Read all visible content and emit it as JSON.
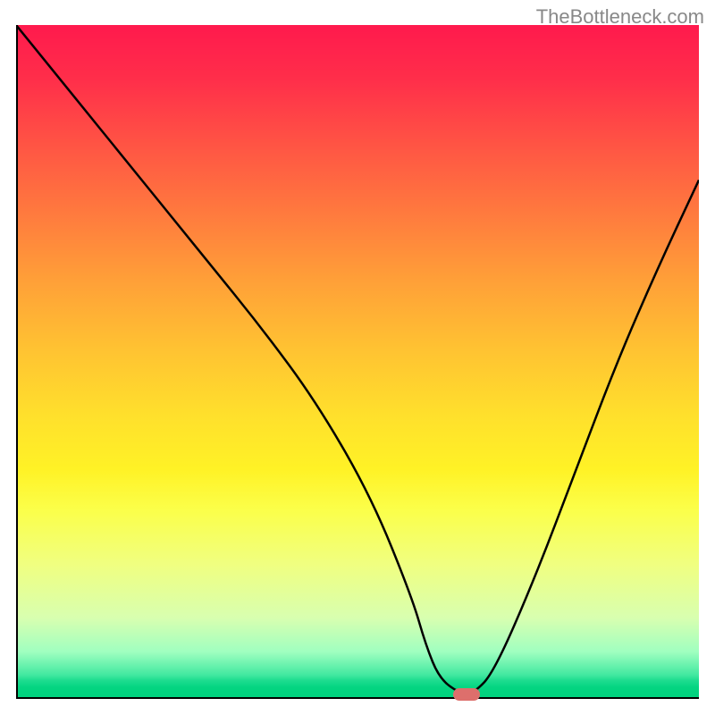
{
  "watermark": "TheBottleneck.com",
  "chart_data": {
    "type": "line",
    "title": "",
    "xlabel": "",
    "ylabel": "",
    "x_range": [
      0,
      100
    ],
    "y_range": [
      0,
      100
    ],
    "background_gradient": {
      "top_color": "#ff1a4d",
      "mid_color": "#ffe02c",
      "bottom_color": "#01d27e",
      "description": "vertical gradient red→orange→yellow→green"
    },
    "series": [
      {
        "name": "bottleneck-curve",
        "color": "#000000",
        "x": [
          0,
          8,
          16,
          24,
          28,
          36,
          44,
          52,
          58,
          60,
          62,
          65,
          67,
          70,
          76,
          82,
          88,
          94,
          100
        ],
        "y": [
          100,
          90,
          80,
          70,
          65,
          55,
          44,
          30,
          15,
          8,
          3,
          0.8,
          0.8,
          4,
          18,
          34,
          50,
          64,
          77
        ]
      }
    ],
    "marker": {
      "x": 66,
      "y": 0.6,
      "shape": "pill",
      "color": "#dd6f6c"
    },
    "axes": {
      "left": true,
      "bottom": true,
      "ticks": false,
      "labels": false
    }
  }
}
